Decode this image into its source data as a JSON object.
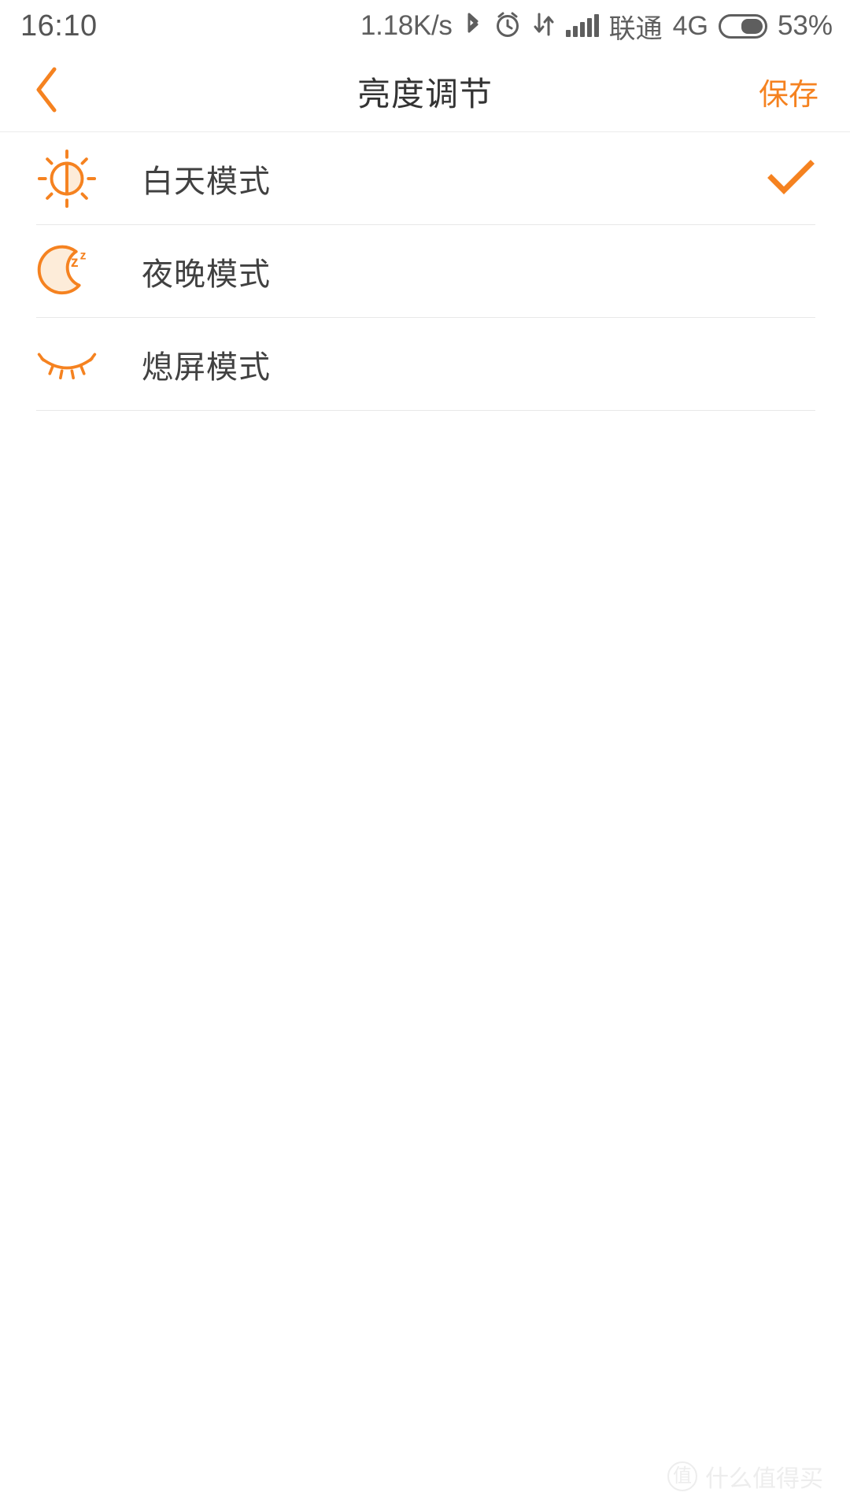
{
  "status_bar": {
    "time": "16:10",
    "network_speed": "1.18K/s",
    "bluetooth_icon": "bluetooth-icon",
    "alarm_icon": "alarm-clock-icon",
    "data_transfer_icon": "data-transfer-icon",
    "signal_icon": "signal-bars-icon",
    "carrier": "联通",
    "network_type": "4G",
    "battery_percent": "53%",
    "battery_level": 53
  },
  "header": {
    "back_label": "返回",
    "back_icon": "chevron-left-icon",
    "title": "亮度调节",
    "save_label": "保存"
  },
  "list": {
    "items": [
      {
        "icon": "sun-icon",
        "label": "白天模式",
        "selected": true,
        "check_icon": "check-icon"
      },
      {
        "icon": "moon-sleep-icon",
        "label": "夜晚模式",
        "selected": false,
        "check_icon": "check-icon"
      },
      {
        "icon": "closed-eye-icon",
        "label": "熄屏模式",
        "selected": false,
        "check_icon": "check-icon"
      }
    ]
  },
  "watermark": {
    "badge": "值",
    "text": "什么值得买"
  },
  "colors": {
    "accent": "#f58220",
    "icon_fill": "#fdecd9",
    "text_primary": "#414141",
    "text_title": "#333333",
    "status_text": "#5e5e5e",
    "divider": "#e8e8e8",
    "background": "#ffffff"
  }
}
